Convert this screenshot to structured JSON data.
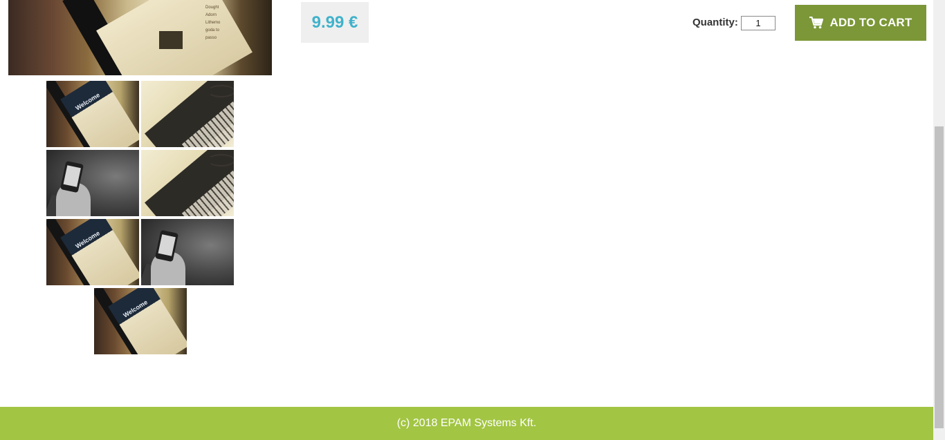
{
  "product": {
    "price": "9.99 €",
    "main_image_text": "Dought\nAdorn\nLithemo\ngoda to\npasso"
  },
  "purchase": {
    "quantity_label": "Quantity:",
    "quantity_value": "1",
    "add_to_cart_label": "ADD TO CART",
    "add_to_cart_icon": "shopping-cart-icon",
    "button_color": "#7b9737"
  },
  "gallery": {
    "thumbnails": [
      "tablet",
      "laptop",
      "phone",
      "laptop",
      "tablet",
      "phone",
      "tablet"
    ],
    "thumbnail_text": "Welcome"
  },
  "footer": {
    "copyright": "(c) 2018 EPAM Systems Kft.",
    "color": "#a2c543"
  },
  "colors": {
    "price_text": "#3fb2cb",
    "price_bg": "#efefef"
  }
}
